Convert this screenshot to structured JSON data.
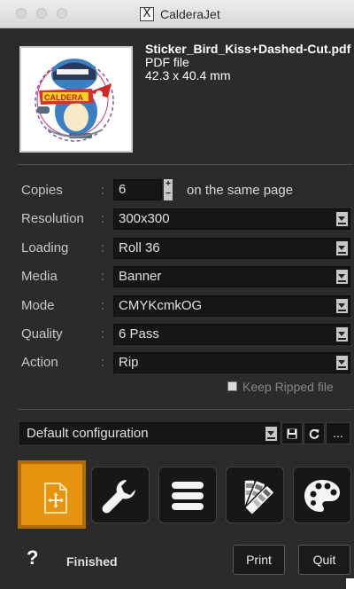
{
  "window": {
    "title": "CalderaJet",
    "app_icon": "caldera-x-icon"
  },
  "file": {
    "name": "Sticker_Bird_Kiss+Dashed-Cut.pdf",
    "type": "PDF file",
    "size": "42.3 x 40.4 mm",
    "thumbnail_text": "CALDERA"
  },
  "settings": {
    "copies": {
      "label": "Copies",
      "value": "6",
      "suffix": "on the same page"
    },
    "resolution": {
      "label": "Resolution",
      "value": "300x300"
    },
    "loading": {
      "label": "Loading",
      "value": "Roll 36"
    },
    "media": {
      "label": "Media",
      "value": "Banner"
    },
    "mode": {
      "label": "Mode",
      "value": "CMYKcmkOG"
    },
    "quality": {
      "label": "Quality",
      "value": "6 Pass"
    },
    "action": {
      "label": "Action",
      "value": "Rip"
    },
    "colon": ":",
    "keep_ripped": {
      "label": "Keep Ripped file",
      "checked": false
    }
  },
  "configuration": {
    "value": "Default configuration",
    "more": "..."
  },
  "toolbar": {
    "active_index": 0,
    "active_color": "#e6940f",
    "icons": [
      "layout-icon",
      "wrench-icon",
      "menu-icon",
      "color-swatches-icon",
      "palette-icon"
    ]
  },
  "footer": {
    "help": "?",
    "status": "Finished",
    "print_label": "Print",
    "quit_label": "Quit"
  }
}
